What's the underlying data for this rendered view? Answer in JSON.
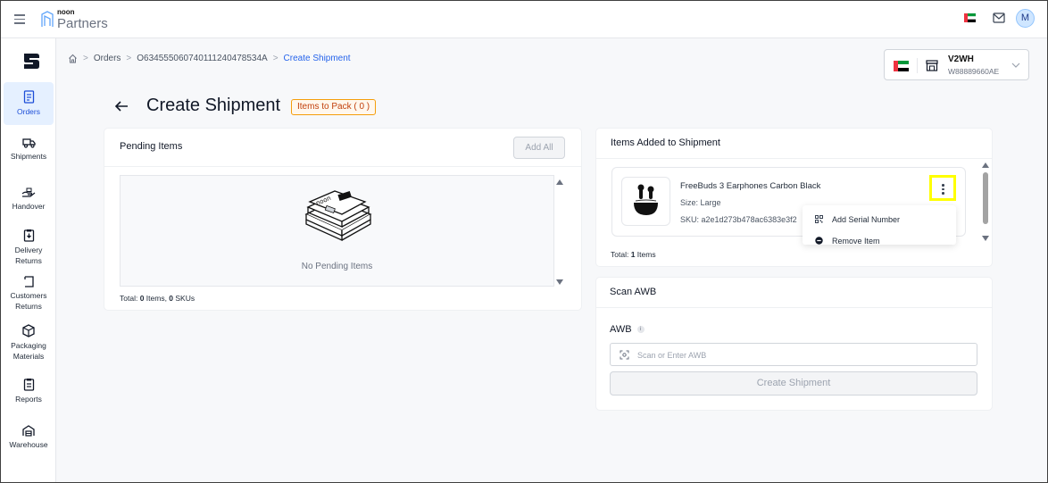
{
  "topbar": {
    "brand_small": "noon",
    "brand_big": "Partners",
    "avatar_initial": "M",
    "icons": [
      "menu-icon",
      "uae-flag-icon",
      "mail-icon"
    ]
  },
  "sidebar": {
    "items": [
      {
        "label": "Orders",
        "icon": "orders-icon",
        "active": true
      },
      {
        "label": "Shipments",
        "icon": "truck-icon"
      },
      {
        "label": "Handover",
        "icon": "handover-icon"
      },
      {
        "label": "Delivery\nReturns",
        "line1": "Delivery",
        "line2": "Returns",
        "icon": "delivery-return-icon"
      },
      {
        "label": "Customers\nReturns",
        "line1": "Customers",
        "line2": "Returns",
        "icon": "customer-return-icon"
      },
      {
        "label": "Packaging\nMaterials",
        "line1": "Packaging",
        "line2": "Materials",
        "icon": "box-icon"
      },
      {
        "label": "Reports",
        "icon": "reports-icon"
      },
      {
        "label": "Warehouse",
        "icon": "warehouse-icon"
      }
    ]
  },
  "breadcrumb": {
    "items": [
      "Orders",
      "O63455506074011112404785 34A",
      "Create Shipment"
    ],
    "orders": "Orders",
    "order_id": "O634555060740111240478534A",
    "current": "Create Shipment"
  },
  "warehouse": {
    "code": "V2WH",
    "id": "W88889660AE"
  },
  "page": {
    "title": "Create Shipment",
    "badge": "Items to Pack ( 0 )"
  },
  "pending": {
    "title": "Pending Items",
    "add_all": "Add All",
    "empty_text": "No Pending Items",
    "total_prefix": "Total: ",
    "total_items": "0",
    "total_mid": " Items, ",
    "total_skus": "0",
    "total_suffix": " SKUs"
  },
  "added": {
    "title": "Items Added to Shipment",
    "item": {
      "name": "FreeBuds 3 Earphones Carbon Black",
      "size": "Size: Large",
      "sku": "SKU: a2e1d273b478ac6383e3f2"
    },
    "menu": {
      "add_serial": "Add Serial Number",
      "remove": "Remove Item"
    },
    "total_prefix": "Total: ",
    "total_count": "1",
    "total_suffix": " Items"
  },
  "scan": {
    "title": "Scan AWB",
    "awb_label": "AWB",
    "info": "i",
    "placeholder": "Scan or Enter AWB",
    "button": "Create Shipment"
  },
  "colors": {
    "accent": "#2563eb",
    "badge_border": "#f59e0b",
    "highlight": "#ffff00",
    "uae_red": "#ef3340",
    "uae_green": "#009739"
  }
}
